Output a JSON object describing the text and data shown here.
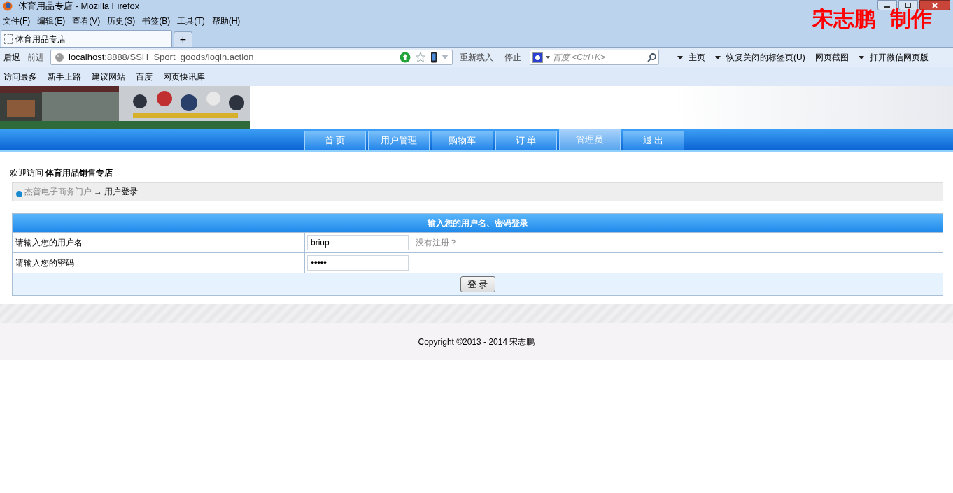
{
  "window": {
    "title": "体育用品专店 - Mozilla Firefox",
    "overlay_caption": "宋志鹏  制作"
  },
  "menu_bar": [
    "文件(F)",
    "编辑(E)",
    "查看(V)",
    "历史(S)",
    "书签(B)",
    "工具(T)",
    "帮助(H)"
  ],
  "tabs": [
    {
      "label": "体育用品专店",
      "selected": true
    }
  ],
  "new_tab": "+",
  "nav_toolbar": {
    "back": "后退",
    "forward": "前进",
    "url_host": "localhost",
    "url_rest": ":8888/SSH_Sport_goods/login.action",
    "reload": "重新载入",
    "stop": "停止",
    "search_placeholder": "百度 <Ctrl+K>",
    "links": [
      "主页",
      "恢复关闭的标签页(U)",
      "网页截图",
      "打开微信网页版"
    ]
  },
  "bookmarks": [
    "访问最多",
    "新手上路",
    "建议网站",
    "百度",
    "网页快讯库"
  ],
  "site_nav": [
    {
      "label": "首 页",
      "selected": false
    },
    {
      "label": "用户管理",
      "selected": false
    },
    {
      "label": "购物车",
      "selected": false
    },
    {
      "label": "订 单",
      "selected": false
    },
    {
      "label": "管理员",
      "selected": true
    },
    {
      "label": "退 出",
      "selected": false
    }
  ],
  "welcome": {
    "prefix": "欢迎访问",
    "store": "体育用品销售专店"
  },
  "breadcrumb": {
    "portal": "杰普电子商务门户",
    "current": "→ 用户登录"
  },
  "login_form": {
    "title": "输入您的用户名、密码登录",
    "username_label": "请输入您的用户名",
    "username_value": "briup",
    "register_link": "没有注册？",
    "password_label": "请输入您的密码",
    "password_masked": "●●●●●",
    "submit": "登 录"
  },
  "footer": {
    "copyright": "Copyright ©2013 - 2014 宋志鹏"
  }
}
